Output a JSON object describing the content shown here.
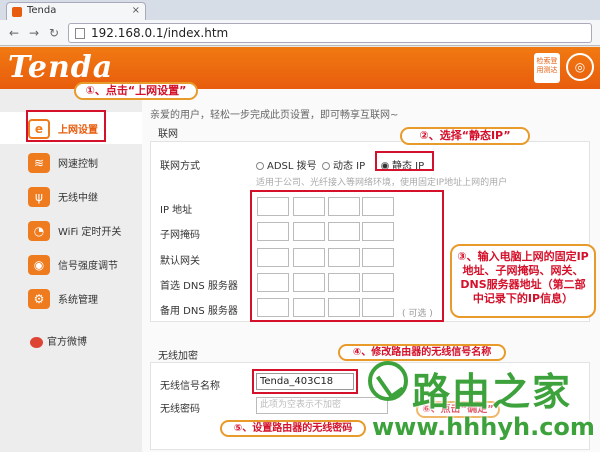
{
  "browser": {
    "tab_title": "Tenda",
    "url": "192.168.0.1/index.htm"
  },
  "header": {
    "logo": "Tenda",
    "badge": "检索登 用测达",
    "circle_icon": "router-icon"
  },
  "sidebar": {
    "items": [
      {
        "label": "上网设置",
        "icon": "ie-icon"
      },
      {
        "label": "网速控制",
        "icon": "speed-icon"
      },
      {
        "label": "无线中继",
        "icon": "wireless-icon"
      },
      {
        "label": "WiFi 定时开关",
        "icon": "timer-icon"
      },
      {
        "label": "信号强度调节",
        "icon": "signal-icon"
      },
      {
        "label": "系统管理",
        "icon": "gear-icon"
      }
    ],
    "weibo": "官方微博"
  },
  "main": {
    "welcome": "亲爱的用户，轻松一步完成此页设置，即可畅享互联网~",
    "network_section": "联网",
    "connection_label": "联网方式",
    "connection_options": [
      "ADSL 拨号",
      "动态 IP",
      "静态 IP"
    ],
    "selected_option": "静态 IP",
    "hint": "适用于公司、光纤接入等网络环境，使用固定IP地址上网的用户",
    "fields": {
      "ip": "IP 地址",
      "mask": "子网掩码",
      "gateway": "默认网关",
      "dns1": "首选 DNS 服务器",
      "dns2": "备用 DNS 服务器"
    },
    "optional": "( 可选 )",
    "wireless_section": "无线加密",
    "ssid_label": "无线信号名称",
    "ssid_value": "Tenda_403C18",
    "password_label": "无线密码",
    "password_placeholder": "此项为空表示不加密"
  },
  "annotations": {
    "step1": "①、点击“上网设置”",
    "step2": "②、选择“静态IP”",
    "step3": "③、输入电脑上网的固定IP地址、子网掩码、网关、DNS服务器地址（第二部中记录下的IP信息）",
    "step4": "④、修改路由器的无线信号名称",
    "step5": "⑤、设置路由器的无线密码",
    "step6": "⑥、点击“确定”"
  },
  "watermark": {
    "text": "路由之家",
    "url": "www.hhhyh.com"
  },
  "colors": {
    "brand_orange": "#e85c0d",
    "annotation_red": "#d4102a",
    "callout_border": "#e89a2a",
    "watermark_green": "#3da23c"
  }
}
